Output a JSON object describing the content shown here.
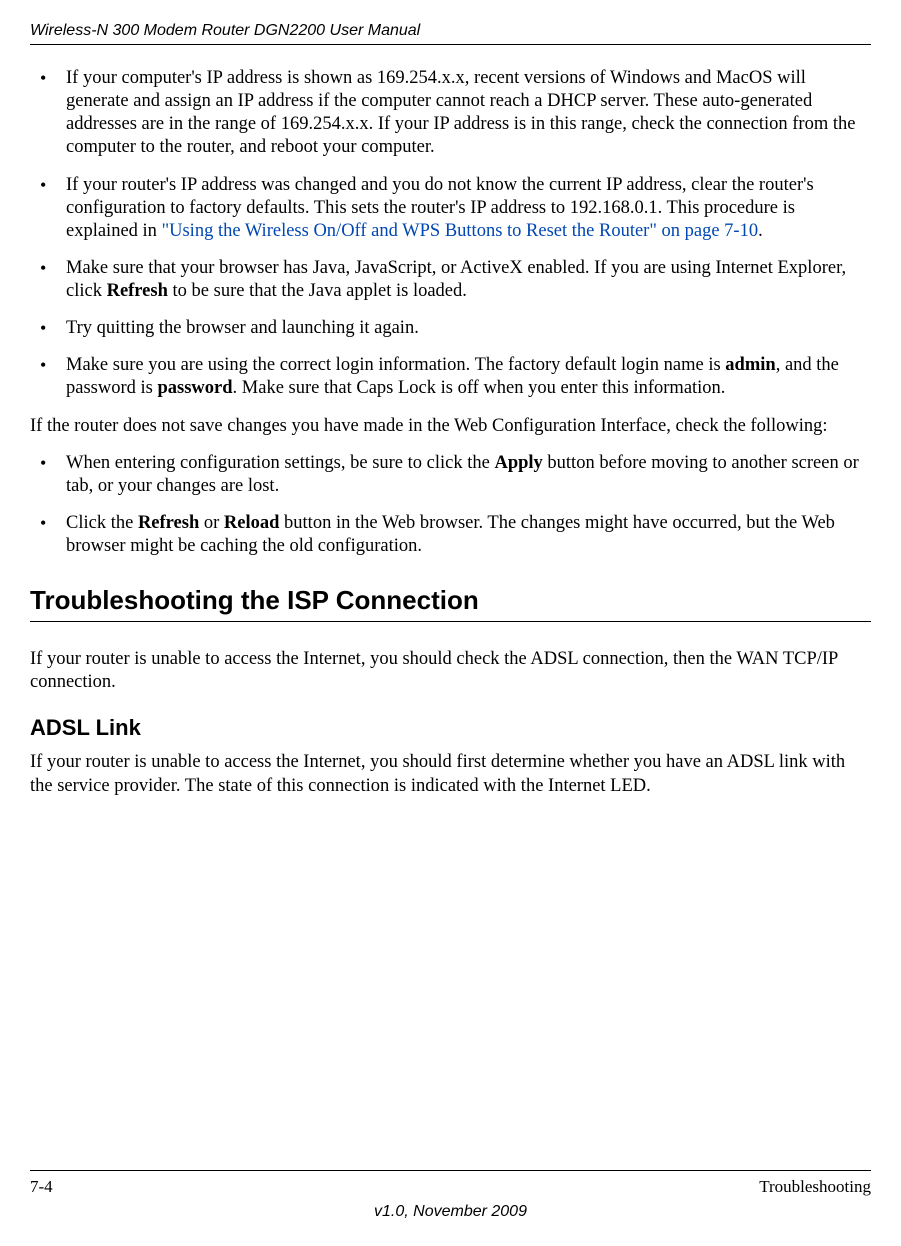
{
  "header": {
    "running_title": "Wireless-N 300 Modem Router DGN2200 User Manual"
  },
  "bullets1": {
    "b1": "If your computer's IP address is shown as 169.254.x.x, recent versions of Windows and MacOS will generate and assign an IP address if the computer cannot reach a DHCP server. These auto-generated addresses are in the range of 169.254.x.x. If your IP address is in this range, check the connection from the computer to the router, and reboot your computer.",
    "b2_pre": "If your router's IP address was changed and you do not know the current IP address, clear the router's configuration to factory defaults. This sets the router's IP address to 192.168.0.1. This procedure is explained in ",
    "b2_link": "\"Using the Wireless On/Off and WPS Buttons to Reset the Router\" on page 7-10",
    "b2_post": ".",
    "b3_pre": "Make sure that your browser has Java, JavaScript, or ActiveX enabled. If you are using Internet Explorer, click ",
    "b3_bold": "Refresh",
    "b3_post": " to be sure that the Java applet is loaded.",
    "b4": "Try quitting the browser and launching it again.",
    "b5_pre": "Make sure you are using the correct login information. The factory default login name is ",
    "b5_bold1": "admin",
    "b5_mid": ", and the password is ",
    "b5_bold2": "password",
    "b5_post": ". Make sure that Caps Lock is off when you enter this information."
  },
  "para1": "If the router does not save changes you have made in the Web Configuration Interface, check the following:",
  "bullets2": {
    "b1_pre": "When entering configuration settings, be sure to click the ",
    "b1_bold": "Apply",
    "b1_post": " button before moving to another screen or tab, or your changes are lost.",
    "b2_pre": "Click the ",
    "b2_bold1": "Refresh",
    "b2_mid": " or ",
    "b2_bold2": "Reload",
    "b2_post": " button in the Web browser. The changes might have occurred, but the Web browser might be caching the old configuration."
  },
  "section": {
    "title": "Troubleshooting the ISP Connection",
    "intro": "If your router is unable to access the Internet, you should check the ADSL connection, then the WAN TCP/IP connection."
  },
  "subsection": {
    "title": "ADSL Link",
    "text": "If your router is unable to access the Internet, you should first determine whether you have an ADSL link with the service provider. The state of this connection is indicated with the Internet LED."
  },
  "footer": {
    "page_number": "7-4",
    "chapter": "Troubleshooting",
    "version": "v1.0, November 2009"
  }
}
